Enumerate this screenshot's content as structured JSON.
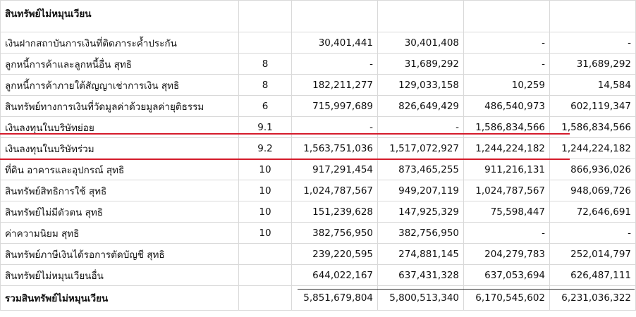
{
  "section_title": "สินทรัพย์ไม่หมุนเวียน",
  "rows": [
    {
      "label": "เงินฝากสถาบันการเงินที่ติดภาระค้ำประกัน",
      "note": "",
      "values": [
        "30,401,441",
        "30,401,408",
        "-",
        "-"
      ]
    },
    {
      "label": "ลูกหนี้การค้าและลูกหนี้อื่น สุทธิ",
      "note": "8",
      "values": [
        "-",
        "31,689,292",
        "-",
        "31,689,292"
      ]
    },
    {
      "label": "ลูกหนี้การค้าภายใต้สัญญาเช่าการเงิน สุทธิ",
      "note": "8",
      "values": [
        "182,211,277",
        "129,033,158",
        "10,259",
        "14,584"
      ]
    },
    {
      "label": "สินทรัพย์ทางการเงินที่วัดมูลค่าด้วยมูลค่ายุติธรรม",
      "note": "6",
      "values": [
        "715,997,689",
        "826,649,429",
        "486,540,973",
        "602,119,347"
      ]
    },
    {
      "label": "เงินลงทุนในบริษัทย่อย",
      "note": "9.1",
      "values": [
        "-",
        "-",
        "1,586,834,566",
        "1,586,834,566"
      ]
    },
    {
      "label": "เงินลงทุนในบริษัทร่วม",
      "note": "9.2",
      "values": [
        "1,563,751,036",
        "1,517,072,927",
        "1,244,224,182",
        "1,244,224,182"
      ]
    },
    {
      "label": "ที่ดิน อาคารและอุปกรณ์ สุทธิ",
      "note": "10",
      "values": [
        "917,291,454",
        "873,465,255",
        "911,216,131",
        "866,936,026"
      ]
    },
    {
      "label": "สินทรัพย์สิทธิการใช้ สุทธิ",
      "note": "10",
      "values": [
        "1,024,787,567",
        "949,207,119",
        "1,024,787,567",
        "948,069,726"
      ]
    },
    {
      "label": "สินทรัพย์ไม่มีตัวตน สุทธิ",
      "note": "10",
      "values": [
        "151,239,628",
        "147,925,329",
        "75,598,447",
        "72,646,691"
      ]
    },
    {
      "label": "ค่าความนิยม สุทธิ",
      "note": "10",
      "values": [
        "382,756,950",
        "382,756,950",
        "-",
        "-"
      ]
    },
    {
      "label": "สินทรัพย์ภาษีเงินได้รอการตัดบัญชี สุทธิ",
      "note": "",
      "values": [
        "239,220,595",
        "274,881,145",
        "204,279,783",
        "252,014,797"
      ]
    },
    {
      "label": "สินทรัพย์ไม่หมุนเวียนอื่น",
      "note": "",
      "values": [
        "644,022,167",
        "637,431,328",
        "637,053,694",
        "626,487,111"
      ]
    }
  ],
  "total": {
    "label": "รวมสินทรัพย์ไม่หมุนเวียน",
    "values": [
      "5,851,679,804",
      "5,800,513,340",
      "6,170,545,602",
      "6,231,036,322"
    ]
  },
  "colors": {
    "highlight_line": "#d51b2b",
    "grid": "#d9d9d9"
  }
}
